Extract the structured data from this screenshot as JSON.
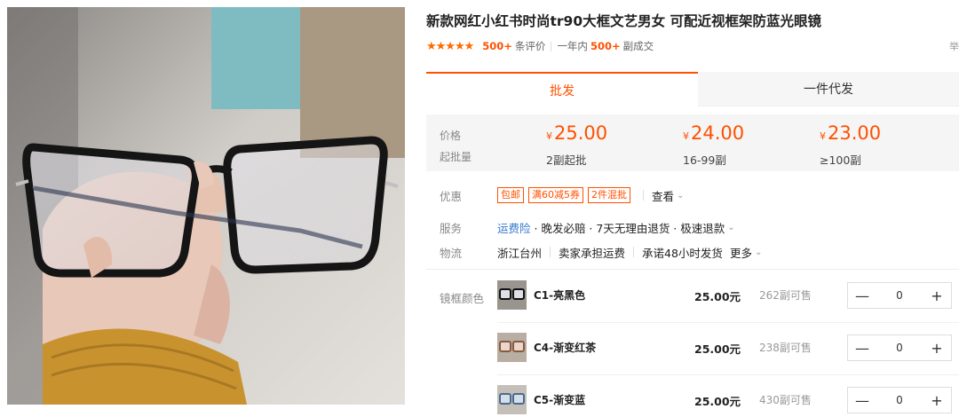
{
  "product": {
    "title": "新款网红小红书时尚tr90大框文艺男女 可配近视框架防蓝光眼镜",
    "stars": "★★★★★",
    "review_count": "500+",
    "review_suffix": "条评价",
    "year_sales_prefix": "一年内",
    "year_sales_count": "500+",
    "year_sales_suffix": "副成交",
    "report_label": "举"
  },
  "tabs": {
    "wholesale": "批发",
    "dropship": "一件代发"
  },
  "pricing": {
    "price_label": "价格",
    "min_qty_label": "起批量",
    "currency": "¥",
    "tiers": [
      {
        "price": "25.00",
        "qty": "2副起批"
      },
      {
        "price": "24.00",
        "qty": "16-99副"
      },
      {
        "price": "23.00",
        "qty": "≥100副"
      }
    ]
  },
  "promo": {
    "label": "优惠",
    "tags": [
      "包邮",
      "满60减5券",
      "2件混批"
    ],
    "view": "查看"
  },
  "service": {
    "label": "服务",
    "insurance": "运费险",
    "items": "· 晚发必赔 · 7天无理由退货 · 极速退款"
  },
  "logistics": {
    "label": "物流",
    "origin": "浙江台州",
    "shipping": "卖家承担运费",
    "promise": "承诺48小时发货",
    "more": "更多"
  },
  "sku": {
    "label": "镜框颜色",
    "items": [
      {
        "name": "C1-亮黑色",
        "price": "25.00元",
        "stock": "262副可售",
        "qty": "0"
      },
      {
        "name": "C4-渐变红茶",
        "price": "25.00元",
        "stock": "238副可售",
        "qty": "0"
      },
      {
        "name": "C5-渐变蓝",
        "price": "25.00元",
        "stock": "430副可售",
        "qty": "0"
      }
    ],
    "minus": "—",
    "plus": "+"
  },
  "icons": {
    "chevron": "chevron-down-icon",
    "star": "star-icon"
  },
  "colors": {
    "accent": "#ff5000",
    "link": "#3377cc"
  }
}
